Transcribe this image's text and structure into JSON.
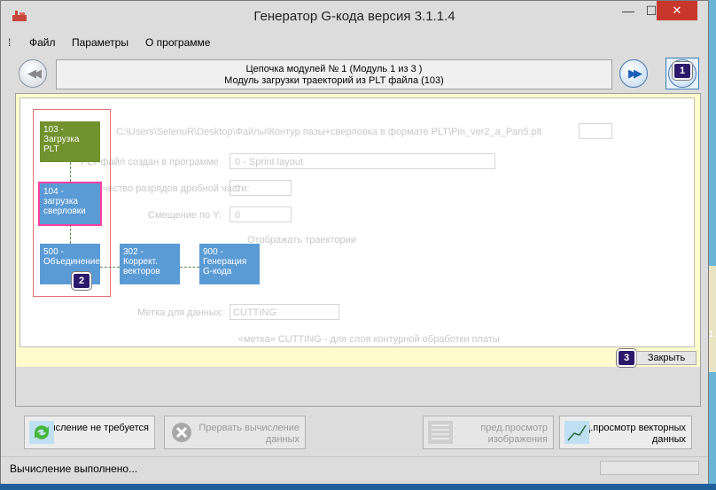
{
  "window": {
    "title": "Генератор G-кода версия 3.1.1.4",
    "min_glyph": "—",
    "max_glyph": "☐",
    "close_glyph": "✕"
  },
  "menu": {
    "items": [
      "Файл",
      "Параметры",
      "О программе"
    ]
  },
  "chain": {
    "line1": "Цепочка модулей № 1 (Модуль 1 из 3 )",
    "line2": "Модуль загрузки траекторий из PLT файла (103)",
    "prev_glyph": "◀◀",
    "next_glyph": "▶▶",
    "last_glyph": "▶▶"
  },
  "badges": [
    "1",
    "2",
    "3"
  ],
  "background_form": {
    "path": "C:\\Users\\SelenuR\\Desktop\\Файлы\\Контур пазы+сверловка в формате PLT\\Pin_ver2_a_Pan5.plt",
    "browse_label": "...",
    "created_in_label": "PLT-файл создан в программе",
    "created_in_value": "0 - Sprint layout",
    "decimals_label": "Количество разрядов дробной части:",
    "decimals_value": "0",
    "offset_y_label": "Смещение по Y:",
    "offset_y_value": "0",
    "show_traj_label": "Отображать траектории",
    "data_label_label": "Метка для данных:",
    "data_label_value": "CUTTING",
    "hint": "«метка» CUTTING - для слоя контурной обработки платы"
  },
  "nodes": {
    "n103": "103 - Загрузка PLT",
    "n104": "104 - загрузка сверловки",
    "n500": "500 - Объединение",
    "n302": "302 - Коррект. векторов",
    "n900": "900 - Генерация G-кода"
  },
  "close_button": "Закрыть",
  "actions": {
    "calc_label": "Вычисление не требуется",
    "abort_label": "Прервать вычисление данных",
    "preview_img_label": "пред.просмотр изображения",
    "preview_vec_label": "пред.просмотр векторных данных"
  },
  "status": {
    "text": "Вычисление выполнено..."
  },
  "colors": {
    "node_green": "#71922e",
    "node_blue": "#5b9bd5",
    "node_highlight": "#ff3da0",
    "canvas_bg": "#fffbcc",
    "badge": "#2b1a6b",
    "close_red": "#c7372b"
  }
}
